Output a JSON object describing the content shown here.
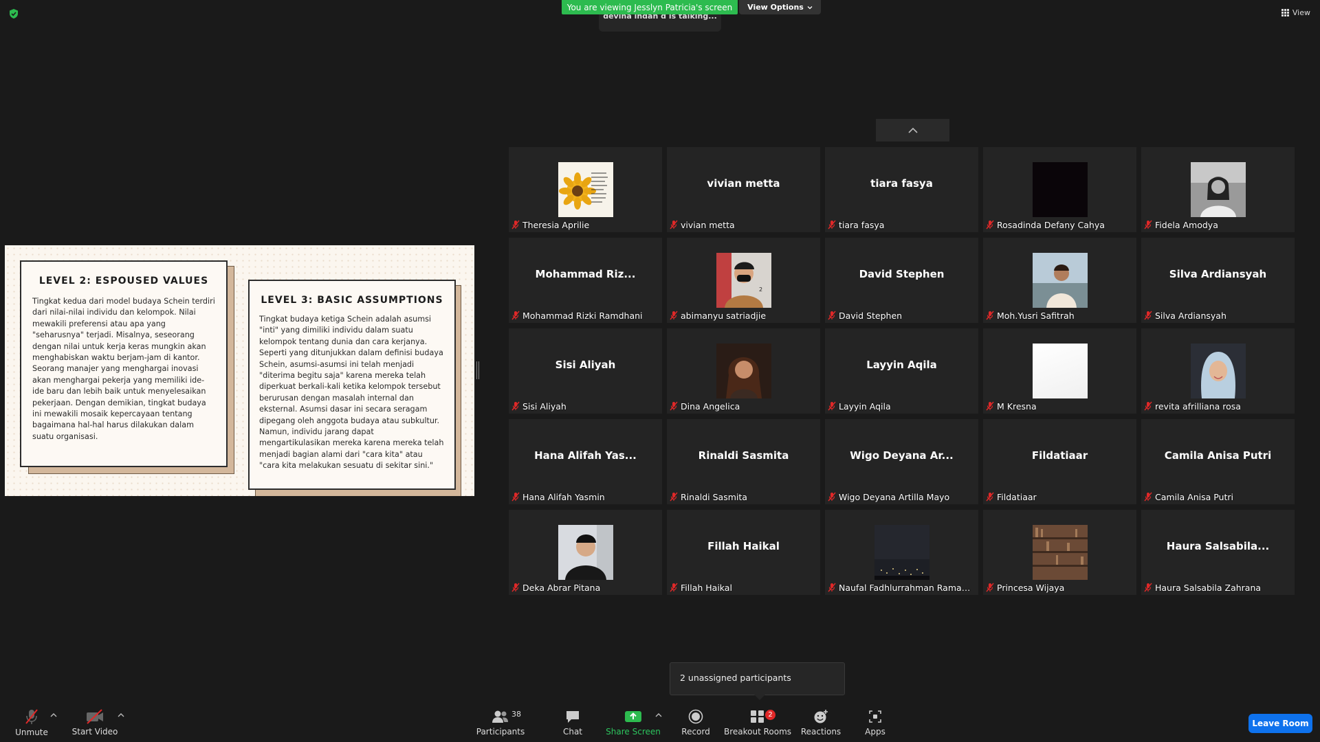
{
  "top": {
    "banner": "You are viewing Jesslyn Patricia's screen",
    "view_options": "View Options",
    "talking": "devina indah d is talking...",
    "view": "View"
  },
  "slide": {
    "card1_title": "LEVEL 2: ESPOUSED VALUES",
    "card1_body": "Tingkat kedua dari model budaya Schein terdiri dari nilai-nilai individu dan kelompok. Nilai mewakili preferensi atau apa yang \"seharusnya\" terjadi. Misalnya, seseorang dengan nilai untuk kerja keras mungkin akan menghabiskan waktu berjam-jam di kantor. Seorang manajer yang menghargai inovasi akan menghargai pekerja yang memiliki ide-ide baru dan lebih baik untuk menyelesaikan pekerjaan. Dengan demikian, tingkat budaya ini mewakili mosaik kepercayaan tentang bagaimana hal-hal harus dilakukan dalam suatu organisasi.",
    "card2_title": "LEVEL 3: BASIC ASSUMPTIONS",
    "card2_body": "Tingkat budaya ketiga Schein adalah asumsi \"inti\" yang dimiliki individu dalam suatu kelompok tentang dunia dan cara kerjanya. Seperti yang ditunjukkan dalam definisi budaya Schein, asumsi-asumsi ini telah menjadi \"diterima begitu saja\" karena mereka telah diperkuat berkali-kali ketika kelompok tersebut berurusan dengan masalah internal dan eksternal. Asumsi dasar ini secara seragam dipegang oleh anggota budaya atau subkultur. Namun, individu jarang dapat mengartikulasikan mereka karena mereka telah menjadi bagian alami dari \"cara kita\" atau \"cara kita melakukan sesuatu di sekitar sini.\""
  },
  "participants": [
    {
      "tile": "",
      "label": "Theresia Aprilie",
      "pic": "sunflower"
    },
    {
      "tile": "vivian metta",
      "label": "vivian metta",
      "pic": ""
    },
    {
      "tile": "tiara fasya",
      "label": "tiara fasya",
      "pic": ""
    },
    {
      "tile": "",
      "label": "Rosadinda Defany Cahya",
      "pic": "dark"
    },
    {
      "tile": "",
      "label": "Fidela Amodya",
      "pic": "person-bw"
    },
    {
      "tile": "Mohammad  Riz...",
      "label": "Mohammad Rizki Ramdhani",
      "pic": ""
    },
    {
      "tile": "",
      "label": "abimanyu satriadjie",
      "pic": "person-mask"
    },
    {
      "tile": "David Stephen",
      "label": "David Stephen",
      "pic": ""
    },
    {
      "tile": "",
      "label": "Moh.Yusri Safitrah",
      "pic": "person-outdoor"
    },
    {
      "tile": "Silva Ardiansyah",
      "label": "Silva Ardiansyah",
      "pic": ""
    },
    {
      "tile": "Sisi Aliyah",
      "label": "Sisi Aliyah",
      "pic": ""
    },
    {
      "tile": "",
      "label": "Dina Angelica",
      "pic": "person-dark"
    },
    {
      "tile": "Layyin Aqila",
      "label": "Layyin Aqila",
      "pic": ""
    },
    {
      "tile": "",
      "label": "M Kresna",
      "pic": "white"
    },
    {
      "tile": "",
      "label": "revita afrilliana rosa",
      "pic": "person-hijab"
    },
    {
      "tile": "Hana Alifah Yas...",
      "label": "Hana Alifah Yasmin",
      "pic": ""
    },
    {
      "tile": "Rinaldi Sasmita",
      "label": "Rinaldi Sasmita",
      "pic": ""
    },
    {
      "tile": "Wigo  Deyana  Ar...",
      "label": "Wigo Deyana Artilla Mayo",
      "pic": ""
    },
    {
      "tile": "Fildatiaar",
      "label": "Fildatiaar",
      "pic": ""
    },
    {
      "tile": "Camila Anisa Putri",
      "label": "Camila Anisa Putri",
      "pic": ""
    },
    {
      "tile": "",
      "label": "Deka Abrar Pitana",
      "pic": "person-jacket"
    },
    {
      "tile": "Fillah Haikal",
      "label": "Fillah Haikal",
      "pic": ""
    },
    {
      "tile": "",
      "label": "Naufal Fadhlurrahman Ramadhan",
      "pic": "night-city"
    },
    {
      "tile": "",
      "label": "Princesa Wijaya",
      "pic": "library"
    },
    {
      "tile": "Haura  Salsabila...",
      "label": "Haura Salsabila Zahrana",
      "pic": ""
    }
  ],
  "tooltip": "2 unassigned participants",
  "toolbar": {
    "unmute": "Unmute",
    "start_video": "Start Video",
    "participants": "Participants",
    "participants_count": "38",
    "chat": "Chat",
    "share_screen": "Share Screen",
    "record": "Record",
    "breakout_rooms": "Breakout Rooms",
    "breakout_badge": "2",
    "reactions": "Reactions",
    "apps": "Apps",
    "leave": "Leave Room"
  },
  "colors": {
    "green": "#2dbb4f",
    "blue": "#0e72ed",
    "red": "#e02828",
    "tile_bg": "#242424"
  }
}
